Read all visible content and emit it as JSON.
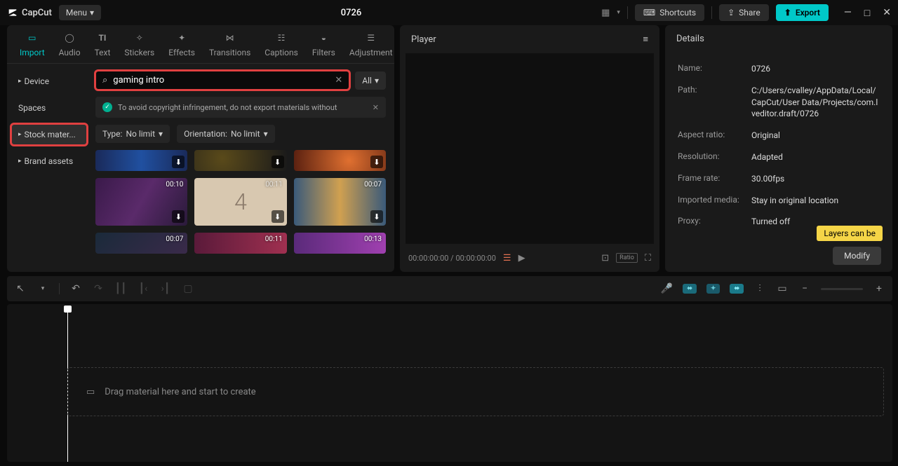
{
  "app": {
    "name": "CapCut",
    "menu": "Menu",
    "project_title": "0726"
  },
  "title_actions": {
    "shortcuts": "Shortcuts",
    "share": "Share",
    "export": "Export"
  },
  "tabs": [
    "Import",
    "Audio",
    "Text",
    "Stickers",
    "Effects",
    "Transitions",
    "Captions",
    "Filters",
    "Adjustment"
  ],
  "sidebar": {
    "device": "Device",
    "spaces": "Spaces",
    "stock": "Stock mater...",
    "brand": "Brand assets"
  },
  "search": {
    "value": "gaming intro",
    "all": "All"
  },
  "notice": "To avoid copyright infringement, do not export materials without",
  "filters": {
    "type_label": "Type:",
    "type_value": "No limit",
    "orient_label": "Orientation:",
    "orient_value": "No limit"
  },
  "thumbs": [
    {
      "dur": ""
    },
    {
      "dur": ""
    },
    {
      "dur": ""
    },
    {
      "dur": "00:10"
    },
    {
      "dur": "00:11",
      "center": "4"
    },
    {
      "dur": "00:07"
    },
    {
      "dur": "00:07"
    },
    {
      "dur": "00:11"
    },
    {
      "dur": "00:13"
    }
  ],
  "player": {
    "title": "Player",
    "time": "00:00:00:00 / 00:00:00:00",
    "ratio": "Ratio"
  },
  "details": {
    "title": "Details",
    "rows": [
      {
        "lbl": "Name:",
        "val": "0726"
      },
      {
        "lbl": "Path:",
        "val": "C:/Users/cvalley/AppData/Local/CapCut/User Data/Projects/com.lveditor.draft/0726"
      },
      {
        "lbl": "Aspect ratio:",
        "val": "Original"
      },
      {
        "lbl": "Resolution:",
        "val": "Adapted"
      },
      {
        "lbl": "Frame rate:",
        "val": "30.00fps"
      },
      {
        "lbl": "Imported media:",
        "val": "Stay in original location"
      },
      {
        "lbl": "Proxy:",
        "val": "Turned off"
      }
    ],
    "tooltip": "Layers can be",
    "modify": "Modify"
  },
  "timeline": {
    "drop_hint": "Drag material here and start to create"
  }
}
